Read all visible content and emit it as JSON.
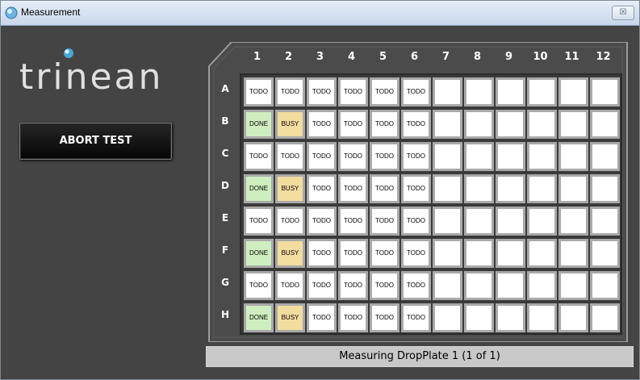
{
  "window": {
    "title": "Measurement",
    "close_glyph": "☒"
  },
  "logo": {
    "text": "trinean",
    "dot_color": "#4aa8d8"
  },
  "actions": {
    "abort_label": "ABORT TEST"
  },
  "plate": {
    "columns": [
      "1",
      "2",
      "3",
      "4",
      "5",
      "6",
      "7",
      "8",
      "9",
      "10",
      "11",
      "12"
    ],
    "rows": [
      "A",
      "B",
      "C",
      "D",
      "E",
      "F",
      "G",
      "H"
    ],
    "wells": [
      [
        "TODO",
        "TODO",
        "TODO",
        "TODO",
        "TODO",
        "TODO",
        "",
        "",
        "",
        "",
        "",
        ""
      ],
      [
        "DONE",
        "BUSY",
        "TODO",
        "TODO",
        "TODO",
        "TODO",
        "",
        "",
        "",
        "",
        "",
        ""
      ],
      [
        "TODO",
        "TODO",
        "TODO",
        "TODO",
        "TODO",
        "TODO",
        "",
        "",
        "",
        "",
        "",
        ""
      ],
      [
        "DONE",
        "BUSY",
        "TODO",
        "TODO",
        "TODO",
        "TODO",
        "",
        "",
        "",
        "",
        "",
        ""
      ],
      [
        "TODO",
        "TODO",
        "TODO",
        "TODO",
        "TODO",
        "TODO",
        "",
        "",
        "",
        "",
        "",
        ""
      ],
      [
        "DONE",
        "BUSY",
        "TODO",
        "TODO",
        "TODO",
        "TODO",
        "",
        "",
        "",
        "",
        "",
        ""
      ],
      [
        "TODO",
        "TODO",
        "TODO",
        "TODO",
        "TODO",
        "TODO",
        "",
        "",
        "",
        "",
        "",
        ""
      ],
      [
        "DONE",
        "BUSY",
        "TODO",
        "TODO",
        "TODO",
        "TODO",
        "",
        "",
        "",
        "",
        "",
        ""
      ]
    ],
    "status_colors": {
      "DONE": "#cfeec0",
      "BUSY": "#f2dc9e",
      "TODO": "#ffffff"
    }
  },
  "status": {
    "text": "Measuring DropPlate 1 (1 of 1)"
  }
}
